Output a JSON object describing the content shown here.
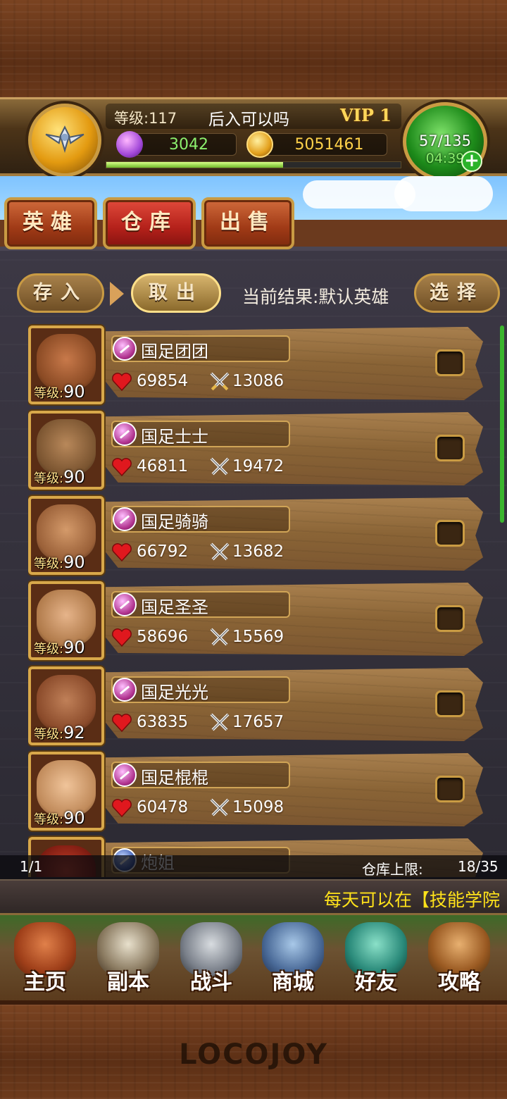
{
  "header": {
    "level_text": "等级:117",
    "player_name": "后入可以吗",
    "vip": "VIP 1",
    "gems": "3042",
    "gold": "5051461",
    "energy": "57/135",
    "energy_timer": "04:39",
    "exp_progress": 0.6
  },
  "tabs": [
    {
      "label": "英雄"
    },
    {
      "label": "仓库"
    },
    {
      "label": "出售"
    }
  ],
  "toolbar": {
    "deposit": "存入",
    "withdraw": "取出",
    "result": "当前结果:默认英雄",
    "select": "选择"
  },
  "heroes": [
    {
      "name": "国足团团",
      "hp": "69854",
      "atk": "13086",
      "level_label": "等级:",
      "level": "90"
    },
    {
      "name": "国足士士",
      "hp": "46811",
      "atk": "19472",
      "level_label": "等级:",
      "level": "90"
    },
    {
      "name": "国足骑骑",
      "hp": "66792",
      "atk": "13682",
      "level_label": "等级:",
      "level": "90"
    },
    {
      "name": "国足圣圣",
      "hp": "58696",
      "atk": "15569",
      "level_label": "等级:",
      "level": "90"
    },
    {
      "name": "国足光光",
      "hp": "63835",
      "atk": "17657",
      "level_label": "等级:",
      "level": "92"
    },
    {
      "name": "国足棍棍",
      "hp": "60478",
      "atk": "15098",
      "level_label": "等级:",
      "level": "90"
    },
    {
      "name": "炮姐"
    }
  ],
  "info": {
    "page": "1/1",
    "capacity_label": "仓库上限:",
    "capacity": "18/35"
  },
  "ticker": "每天可以在【技能学院",
  "nav": [
    {
      "label": "主页",
      "icon": "home-icon"
    },
    {
      "label": "副本",
      "icon": "dungeon-icon"
    },
    {
      "label": "战斗",
      "icon": "battle-icon"
    },
    {
      "label": "商城",
      "icon": "shop-icon"
    },
    {
      "label": "好友",
      "icon": "friends-icon"
    },
    {
      "label": "攻略",
      "icon": "guide-icon"
    }
  ],
  "logo": "LOCOJOY",
  "colors": {
    "accent_gold": "#c99b43",
    "hp_red": "#e0181e",
    "ticker_yellow": "#ffe21a",
    "gem_value_green": "#8cf06e"
  }
}
